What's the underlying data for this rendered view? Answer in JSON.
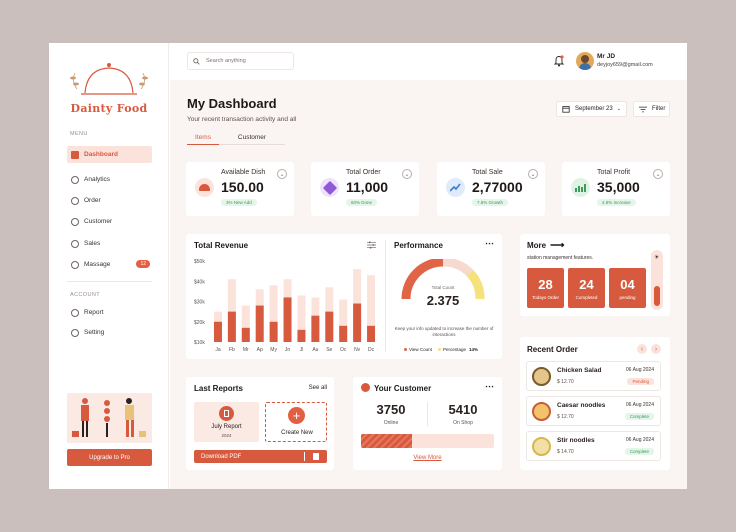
{
  "brand": {
    "name": "Dainty Food"
  },
  "sidebar": {
    "menu_label": "MENU",
    "account_label": "ACCOUNT",
    "items": [
      {
        "label": "Dashboard"
      },
      {
        "label": "Analytics"
      },
      {
        "label": "Order"
      },
      {
        "label": "Customer"
      },
      {
        "label": "Sales"
      },
      {
        "label": "Massage",
        "badge": "12"
      }
    ],
    "account_items": [
      {
        "label": "Report"
      },
      {
        "label": "Setting"
      }
    ],
    "upgrade_label": "Upgrade to Pro"
  },
  "topbar": {
    "search_placeholder": "Search anything",
    "user_name": "Mr JD",
    "user_email": "deyjoy659@gmail.com"
  },
  "header": {
    "title": "My Dashboard",
    "subtitle": "Your recent transaction activity and all",
    "tabs": [
      "Items",
      "Customer"
    ],
    "date": "September 23",
    "filter_label": "Filter"
  },
  "stats": [
    {
      "title": "Available Dish",
      "value": "150.00",
      "pill": "3% New Add"
    },
    {
      "title": "Total Order",
      "value": "11,000",
      "pill": "60% Done"
    },
    {
      "title": "Total Sale",
      "value": "2,77000",
      "pill": "7.8% Growth"
    },
    {
      "title": "Total Profit",
      "value": "35,000",
      "pill": "4.8% Increase"
    }
  ],
  "revenue": {
    "title": "Total Revenue",
    "chart_data": {
      "type": "bar",
      "categories": [
        "Ja",
        "Fb",
        "Mr",
        "Ap",
        "My",
        "Jn",
        "Jl",
        "Au",
        "Se",
        "Oc",
        "Nv",
        "Dc"
      ],
      "series": [
        {
          "values": [
            20,
            25,
            17,
            28,
            20,
            32,
            16,
            23,
            25,
            18,
            29,
            18
          ]
        },
        {
          "values": [
            25,
            41,
            28,
            36,
            38,
            41,
            33,
            32,
            37,
            31,
            46,
            43
          ]
        }
      ],
      "yticks": [
        "$50k",
        "$40k",
        "$30k",
        "$20k",
        "$10k"
      ],
      "ylim": [
        10,
        50
      ],
      "colors": {
        "bar": "#d85a3e",
        "bg": "#fbe3dc"
      }
    }
  },
  "performance": {
    "title": "Performance",
    "center_label": "Total Count",
    "center_value": "2.375",
    "note": "Keep your info updated to increase the number of interactions",
    "legend": [
      "View Count",
      "Percentage"
    ],
    "legend_value": "14%"
  },
  "more": {
    "title": "More",
    "subtitle": "station management features.",
    "boxes": [
      {
        "value": "28",
        "label": "Todays Order"
      },
      {
        "value": "24",
        "label": "Completed"
      },
      {
        "value": "04",
        "label": "pending"
      }
    ]
  },
  "reports": {
    "title": "Last Reports",
    "see_all": "See all",
    "report_name": "July Report",
    "report_year": "2024",
    "create_label": "Create New",
    "download_label": "Download PDF"
  },
  "customer": {
    "title": "Your Customer",
    "online_value": "3750",
    "online_label": "Online",
    "shop_value": "5410",
    "shop_label": "On Shop",
    "progress": 0.38,
    "view_more": "View More"
  },
  "recent_order": {
    "title": "Recent Order",
    "orders": [
      {
        "name": "Chicken Salad",
        "price": "$ 12.70",
        "date": "06 Aug 2024",
        "status": "Pending"
      },
      {
        "name": "Caesar noodles",
        "price": "$ 12.70",
        "date": "06 Aug 2024",
        "status": "Complete"
      },
      {
        "name": "Stir noodles",
        "price": "$ 14.70",
        "date": "06 Aug 2024",
        "status": "Complete"
      }
    ]
  }
}
